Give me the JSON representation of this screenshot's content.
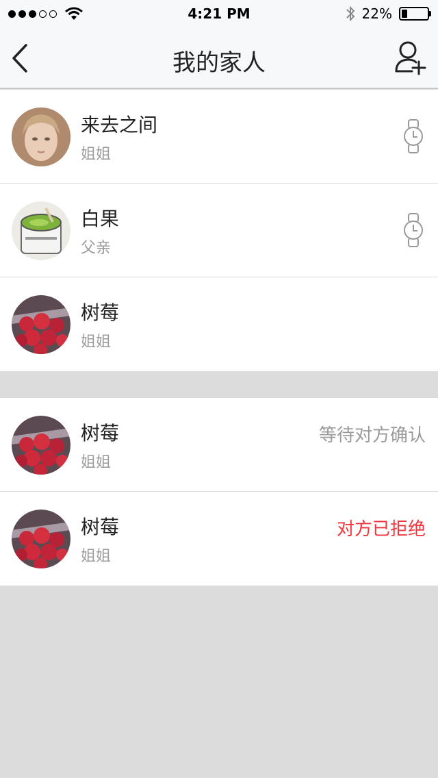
{
  "status_bar": {
    "signal_dots_filled": 3,
    "signal_dots_total": 5,
    "wifi_icon": "wifi-icon",
    "time": "4:21 PM",
    "bluetooth_icon": "bluetooth-icon",
    "battery_percent_text": "22%",
    "battery_level": 0.22
  },
  "nav": {
    "title": "我的家人",
    "back_icon": "chevron-left-icon",
    "add_icon": "add-person-icon"
  },
  "family": [
    {
      "name": "来去之间",
      "relation": "姐姐",
      "avatar": "portrait-girl",
      "icon": "watch-icon"
    },
    {
      "name": "白果",
      "relation": "父亲",
      "avatar": "green-soup-cup",
      "icon": "watch-icon"
    },
    {
      "name": "树莓",
      "relation": "姐姐",
      "avatar": "raspberries"
    }
  ],
  "requests": [
    {
      "name": "树莓",
      "relation": "姐姐",
      "avatar": "raspberries",
      "status": "等待对方确认",
      "status_color": "#9b9b9b"
    },
    {
      "name": "树莓",
      "relation": "姐姐",
      "avatar": "raspberries",
      "status": "对方已拒绝",
      "status_color": "#f0363b"
    }
  ],
  "colors": {
    "background": "#dcdcdc",
    "nav_background": "#f7f8fa",
    "reject_red": "#f0363b",
    "pending_gray": "#9b9b9b"
  }
}
